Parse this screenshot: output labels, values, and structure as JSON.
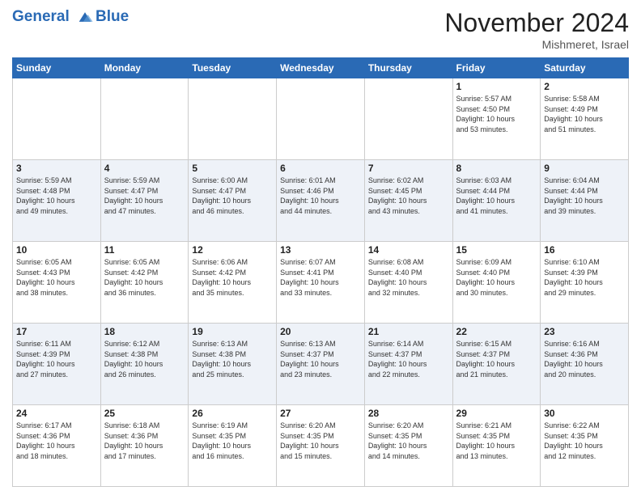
{
  "header": {
    "logo_line1": "General",
    "logo_line2": "Blue",
    "month_title": "November 2024",
    "location": "Mishmeret, Israel"
  },
  "weekdays": [
    "Sunday",
    "Monday",
    "Tuesday",
    "Wednesday",
    "Thursday",
    "Friday",
    "Saturday"
  ],
  "rows": [
    [
      {
        "day": "",
        "info": ""
      },
      {
        "day": "",
        "info": ""
      },
      {
        "day": "",
        "info": ""
      },
      {
        "day": "",
        "info": ""
      },
      {
        "day": "",
        "info": ""
      },
      {
        "day": "1",
        "info": "Sunrise: 5:57 AM\nSunset: 4:50 PM\nDaylight: 10 hours\nand 53 minutes."
      },
      {
        "day": "2",
        "info": "Sunrise: 5:58 AM\nSunset: 4:49 PM\nDaylight: 10 hours\nand 51 minutes."
      }
    ],
    [
      {
        "day": "3",
        "info": "Sunrise: 5:59 AM\nSunset: 4:48 PM\nDaylight: 10 hours\nand 49 minutes."
      },
      {
        "day": "4",
        "info": "Sunrise: 5:59 AM\nSunset: 4:47 PM\nDaylight: 10 hours\nand 47 minutes."
      },
      {
        "day": "5",
        "info": "Sunrise: 6:00 AM\nSunset: 4:47 PM\nDaylight: 10 hours\nand 46 minutes."
      },
      {
        "day": "6",
        "info": "Sunrise: 6:01 AM\nSunset: 4:46 PM\nDaylight: 10 hours\nand 44 minutes."
      },
      {
        "day": "7",
        "info": "Sunrise: 6:02 AM\nSunset: 4:45 PM\nDaylight: 10 hours\nand 43 minutes."
      },
      {
        "day": "8",
        "info": "Sunrise: 6:03 AM\nSunset: 4:44 PM\nDaylight: 10 hours\nand 41 minutes."
      },
      {
        "day": "9",
        "info": "Sunrise: 6:04 AM\nSunset: 4:44 PM\nDaylight: 10 hours\nand 39 minutes."
      }
    ],
    [
      {
        "day": "10",
        "info": "Sunrise: 6:05 AM\nSunset: 4:43 PM\nDaylight: 10 hours\nand 38 minutes."
      },
      {
        "day": "11",
        "info": "Sunrise: 6:05 AM\nSunset: 4:42 PM\nDaylight: 10 hours\nand 36 minutes."
      },
      {
        "day": "12",
        "info": "Sunrise: 6:06 AM\nSunset: 4:42 PM\nDaylight: 10 hours\nand 35 minutes."
      },
      {
        "day": "13",
        "info": "Sunrise: 6:07 AM\nSunset: 4:41 PM\nDaylight: 10 hours\nand 33 minutes."
      },
      {
        "day": "14",
        "info": "Sunrise: 6:08 AM\nSunset: 4:40 PM\nDaylight: 10 hours\nand 32 minutes."
      },
      {
        "day": "15",
        "info": "Sunrise: 6:09 AM\nSunset: 4:40 PM\nDaylight: 10 hours\nand 30 minutes."
      },
      {
        "day": "16",
        "info": "Sunrise: 6:10 AM\nSunset: 4:39 PM\nDaylight: 10 hours\nand 29 minutes."
      }
    ],
    [
      {
        "day": "17",
        "info": "Sunrise: 6:11 AM\nSunset: 4:39 PM\nDaylight: 10 hours\nand 27 minutes."
      },
      {
        "day": "18",
        "info": "Sunrise: 6:12 AM\nSunset: 4:38 PM\nDaylight: 10 hours\nand 26 minutes."
      },
      {
        "day": "19",
        "info": "Sunrise: 6:13 AM\nSunset: 4:38 PM\nDaylight: 10 hours\nand 25 minutes."
      },
      {
        "day": "20",
        "info": "Sunrise: 6:13 AM\nSunset: 4:37 PM\nDaylight: 10 hours\nand 23 minutes."
      },
      {
        "day": "21",
        "info": "Sunrise: 6:14 AM\nSunset: 4:37 PM\nDaylight: 10 hours\nand 22 minutes."
      },
      {
        "day": "22",
        "info": "Sunrise: 6:15 AM\nSunset: 4:37 PM\nDaylight: 10 hours\nand 21 minutes."
      },
      {
        "day": "23",
        "info": "Sunrise: 6:16 AM\nSunset: 4:36 PM\nDaylight: 10 hours\nand 20 minutes."
      }
    ],
    [
      {
        "day": "24",
        "info": "Sunrise: 6:17 AM\nSunset: 4:36 PM\nDaylight: 10 hours\nand 18 minutes."
      },
      {
        "day": "25",
        "info": "Sunrise: 6:18 AM\nSunset: 4:36 PM\nDaylight: 10 hours\nand 17 minutes."
      },
      {
        "day": "26",
        "info": "Sunrise: 6:19 AM\nSunset: 4:35 PM\nDaylight: 10 hours\nand 16 minutes."
      },
      {
        "day": "27",
        "info": "Sunrise: 6:20 AM\nSunset: 4:35 PM\nDaylight: 10 hours\nand 15 minutes."
      },
      {
        "day": "28",
        "info": "Sunrise: 6:20 AM\nSunset: 4:35 PM\nDaylight: 10 hours\nand 14 minutes."
      },
      {
        "day": "29",
        "info": "Sunrise: 6:21 AM\nSunset: 4:35 PM\nDaylight: 10 hours\nand 13 minutes."
      },
      {
        "day": "30",
        "info": "Sunrise: 6:22 AM\nSunset: 4:35 PM\nDaylight: 10 hours\nand 12 minutes."
      }
    ]
  ]
}
